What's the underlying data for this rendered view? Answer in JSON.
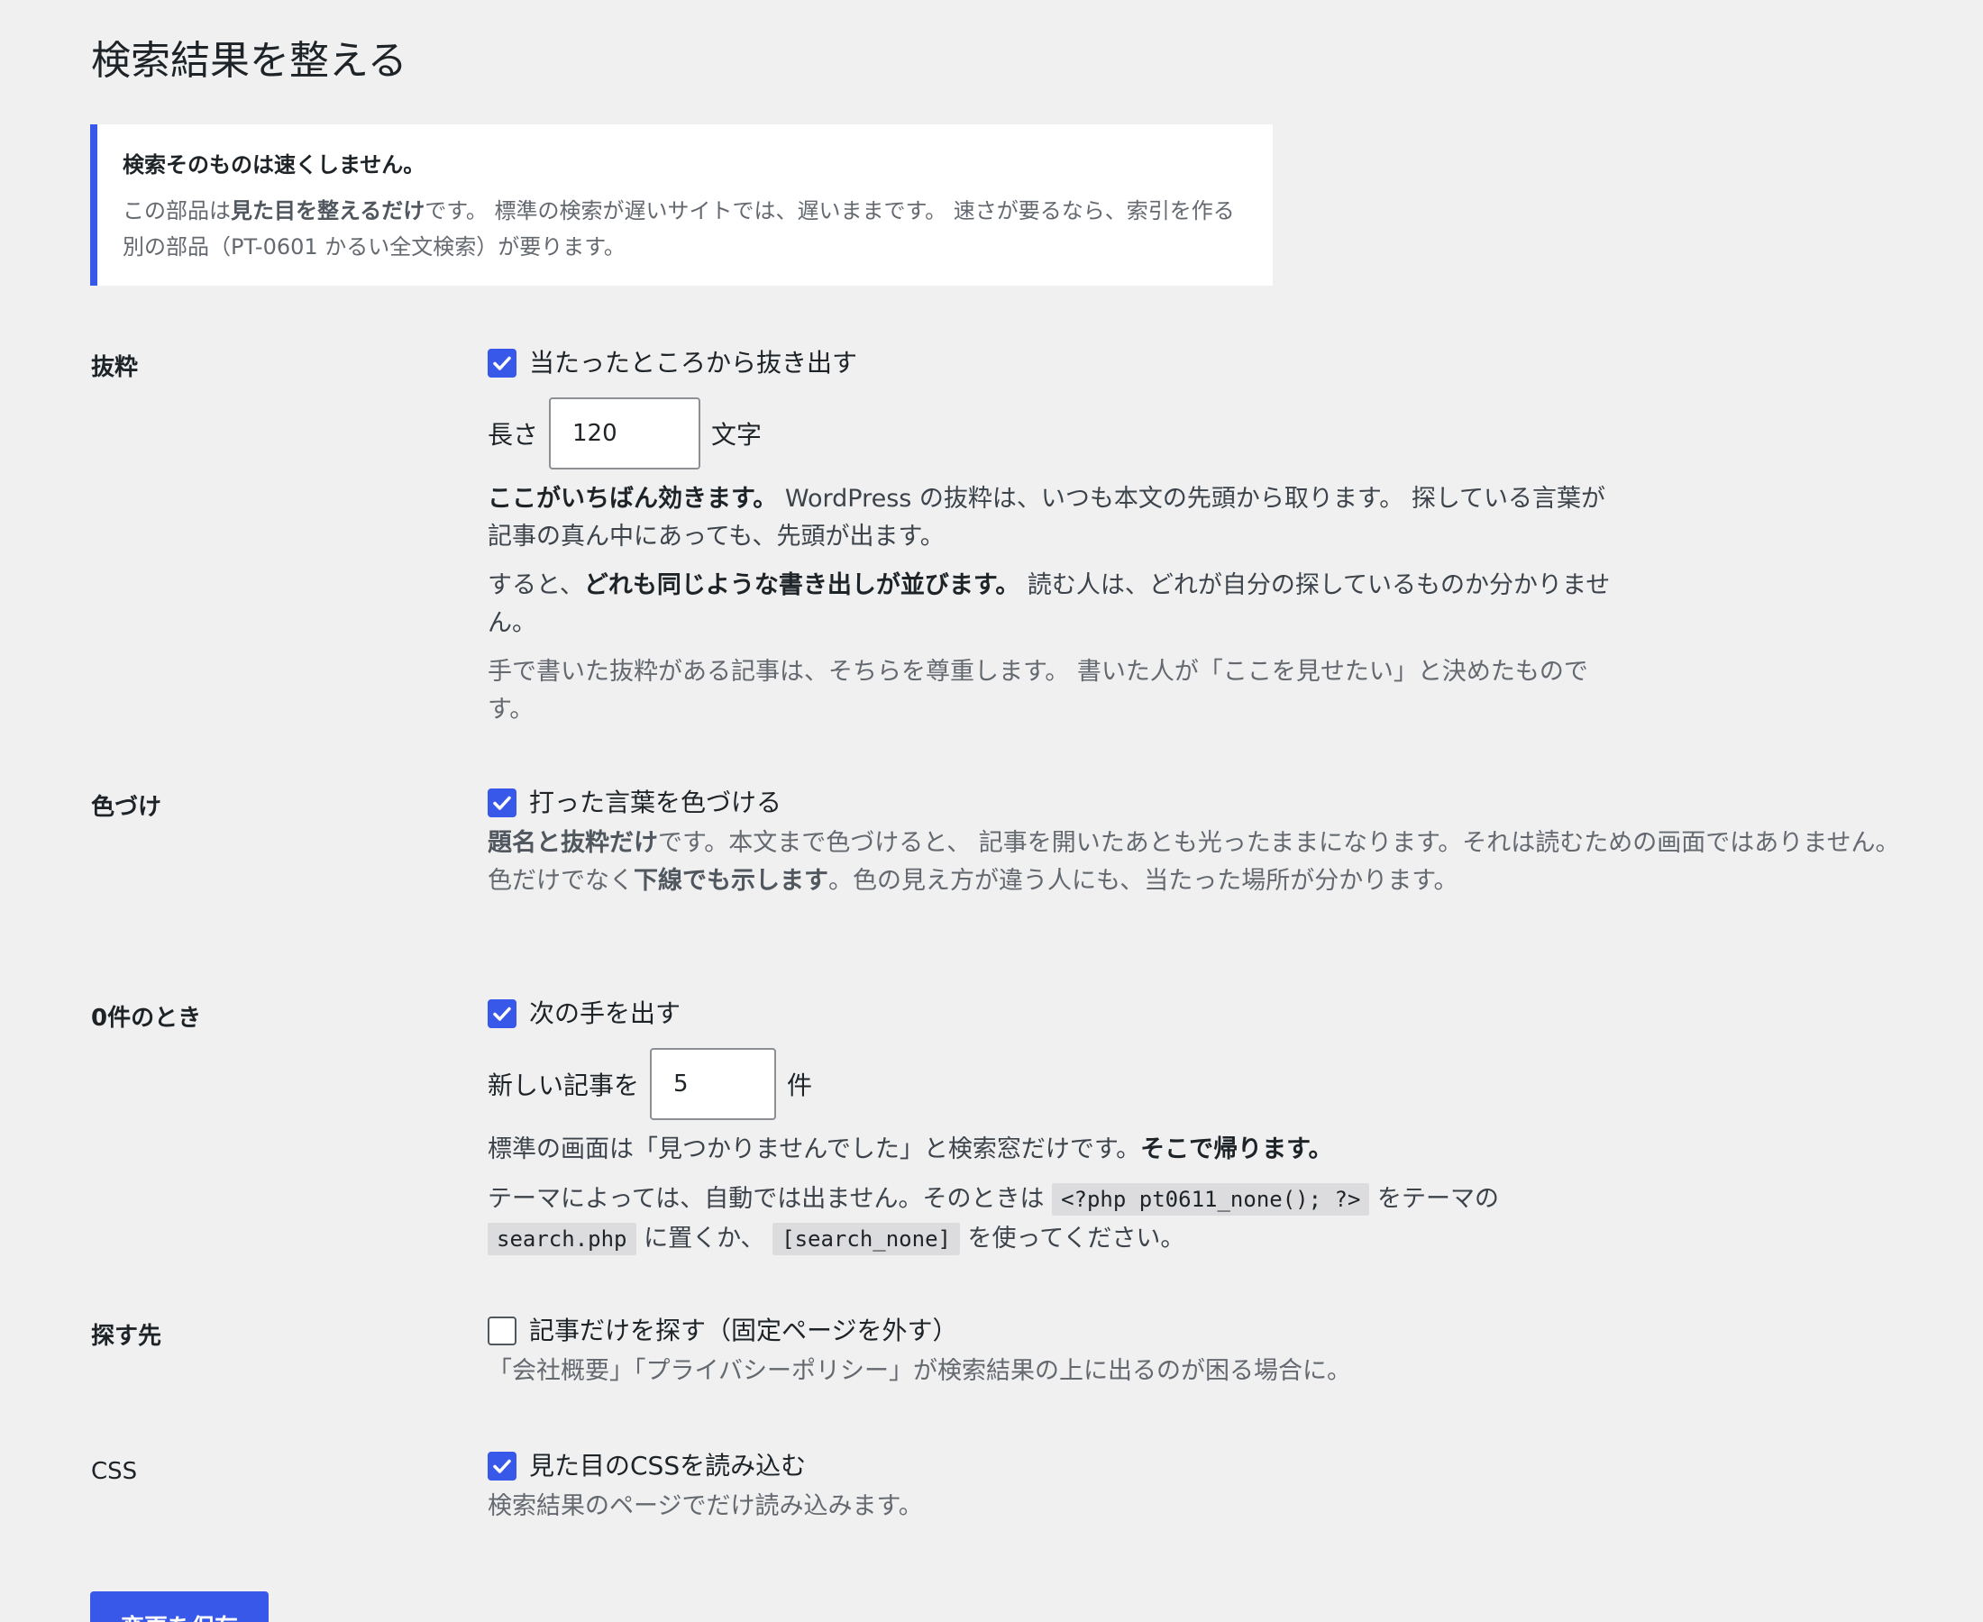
{
  "page": {
    "title": "検索結果を整える"
  },
  "notice": {
    "title": "検索そのものは速くしません。",
    "body_pre": "この部品は",
    "body_bold": "見た目を整えるだけ",
    "body_post": "です。 標準の検索が遅いサイトでは、遅いままです。 速さが要るなら、索引を作る別の部品（PT-0601 かるい全文検索）が要ります。"
  },
  "excerpt": {
    "label": "抜粋",
    "checkbox_label": "当たったところから抜き出す",
    "checked": true,
    "length_label": "長さ",
    "length_value": "120",
    "length_unit": "文字",
    "p1_bold": "ここがいちばん効きます。",
    "p1_rest": " WordPress の抜粋は、いつも本文の先頭から取ります。 探している言葉が記事の真ん中にあっても、先頭が出ます。",
    "p2_pre": "すると、",
    "p2_bold": "どれも同じような書き出しが並びます。",
    "p2_post": " 読む人は、どれが自分の探しているものか分かりません。",
    "p3": "手で書いた抜粋がある記事は、そちらを尊重します。 書いた人が「ここを見せたい」と決めたものです。"
  },
  "highlight": {
    "label": "色づけ",
    "checkbox_label": "打った言葉を色づける",
    "checked": true,
    "p1_bold": "題名と抜粋だけ",
    "p1_rest": "です。本文まで色づけると、 記事を開いたあとも光ったままになります。それは読むための画面ではありません。",
    "p2_pre": "色だけでなく",
    "p2_bold": "下線でも示します",
    "p2_post": "。色の見え方が違う人にも、当たった場所が分かります。"
  },
  "zero": {
    "label": "0件のとき",
    "checkbox_label": "次の手を出す",
    "checked": true,
    "count_label": "新しい記事を",
    "count_value": "5",
    "count_unit": "件",
    "p1_pre": "標準の画面は「見つかりませんでした」と検索窓だけです。",
    "p1_bold": "そこで帰ります。",
    "p2_a": "テーマによっては、自動では出ません。そのときは ",
    "p2_code1": "<?php pt0611_none(); ?>",
    "p2_b": " をテーマの ",
    "p2_code2": "search.php",
    "p2_c": " に置くか、 ",
    "p2_code3": "[search_none]",
    "p2_d": " を使ってください。"
  },
  "scope": {
    "label": "探す先",
    "checkbox_label": "記事だけを探す（固定ページを外す）",
    "checked": false,
    "p1": "「会社概要」「プライバシーポリシー」が検索結果の上に出るのが困る場合に。"
  },
  "css": {
    "label": "CSS",
    "checkbox_label": "見た目のCSSを読み込む",
    "checked": true,
    "p1": "検索結果のページでだけ読み込みます。"
  },
  "footer": {
    "save_label": "変更を保存"
  },
  "colors": {
    "accent": "#3858e9",
    "background": "#f0f0f1",
    "text": "#1d2327",
    "muted_text": "#646970"
  },
  "icons": {
    "checkbox_checked": "checkmark-icon"
  }
}
